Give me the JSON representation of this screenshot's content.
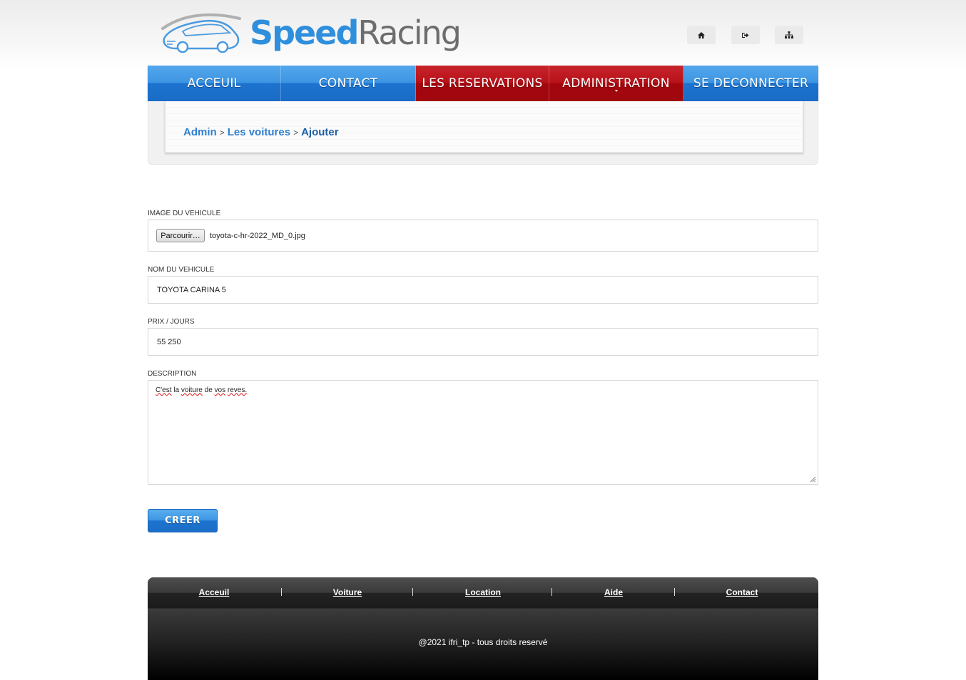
{
  "header": {
    "logo": {
      "speed": "Speed",
      "racing": "Racing"
    },
    "icons": [
      "home-icon",
      "sign-out-icon",
      "sitemap-icon"
    ]
  },
  "nav": {
    "items": [
      {
        "label": "Acceuil",
        "state": "normal"
      },
      {
        "label": "Contact",
        "state": "normal"
      },
      {
        "label": "Les reservations",
        "state": "active"
      },
      {
        "label": "Administration",
        "state": "active-dropdown"
      },
      {
        "label": "Se deconnecter",
        "state": "normal"
      }
    ]
  },
  "breadcrumb": {
    "items": [
      "Admin",
      "Les voitures",
      "Ajouter"
    ],
    "separator": ">"
  },
  "form": {
    "image": {
      "label": "IMAGE DU VEHICULE",
      "button": "Parcourir…",
      "filename": "toyota-c-hr-2022_MD_0.jpg"
    },
    "name": {
      "label": "NOM DU VEHICULE",
      "value": "TOYOTA CARINA 5"
    },
    "price": {
      "label": "PRIX / JOURS",
      "value": "55 250"
    },
    "description": {
      "label": "DESCRIPTION",
      "words": [
        "C'est",
        "la",
        "voiture",
        "de",
        "vos",
        "reves."
      ]
    },
    "submit": "CREER"
  },
  "footer": {
    "links": [
      "Acceuil",
      "Voiture",
      "Location",
      "Aide",
      "Contact"
    ],
    "copyright": "@2021 ifri_tp - tous droits reservé"
  },
  "colors": {
    "blue": "#2f8fdc",
    "red": "#b81219",
    "breadcrumb": "#2f7fcf"
  }
}
